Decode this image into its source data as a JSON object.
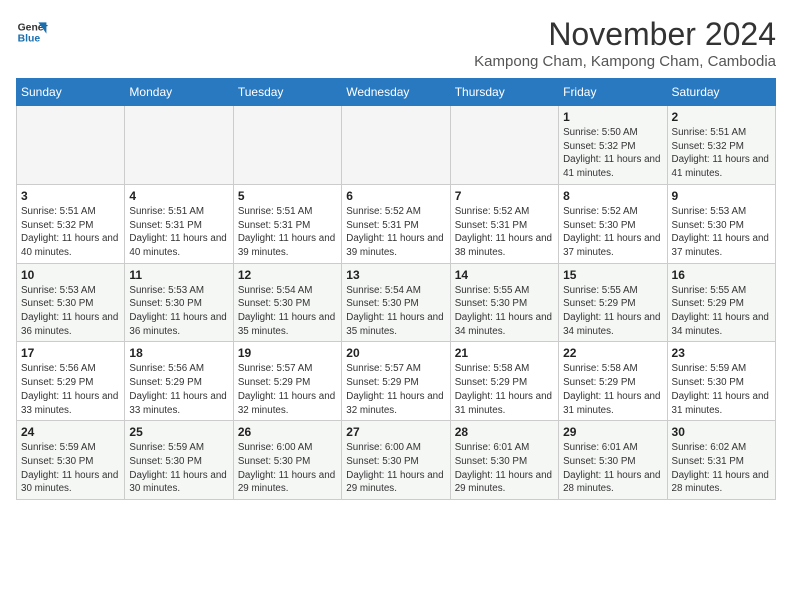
{
  "header": {
    "logo_line1": "General",
    "logo_line2": "Blue",
    "month_title": "November 2024",
    "location": "Kampong Cham, Kampong Cham, Cambodia"
  },
  "weekdays": [
    "Sunday",
    "Monday",
    "Tuesday",
    "Wednesday",
    "Thursday",
    "Friday",
    "Saturday"
  ],
  "weeks": [
    [
      {
        "day": "",
        "info": ""
      },
      {
        "day": "",
        "info": ""
      },
      {
        "day": "",
        "info": ""
      },
      {
        "day": "",
        "info": ""
      },
      {
        "day": "",
        "info": ""
      },
      {
        "day": "1",
        "info": "Sunrise: 5:50 AM\nSunset: 5:32 PM\nDaylight: 11 hours and 41 minutes."
      },
      {
        "day": "2",
        "info": "Sunrise: 5:51 AM\nSunset: 5:32 PM\nDaylight: 11 hours and 41 minutes."
      }
    ],
    [
      {
        "day": "3",
        "info": "Sunrise: 5:51 AM\nSunset: 5:32 PM\nDaylight: 11 hours and 40 minutes."
      },
      {
        "day": "4",
        "info": "Sunrise: 5:51 AM\nSunset: 5:31 PM\nDaylight: 11 hours and 40 minutes."
      },
      {
        "day": "5",
        "info": "Sunrise: 5:51 AM\nSunset: 5:31 PM\nDaylight: 11 hours and 39 minutes."
      },
      {
        "day": "6",
        "info": "Sunrise: 5:52 AM\nSunset: 5:31 PM\nDaylight: 11 hours and 39 minutes."
      },
      {
        "day": "7",
        "info": "Sunrise: 5:52 AM\nSunset: 5:31 PM\nDaylight: 11 hours and 38 minutes."
      },
      {
        "day": "8",
        "info": "Sunrise: 5:52 AM\nSunset: 5:30 PM\nDaylight: 11 hours and 37 minutes."
      },
      {
        "day": "9",
        "info": "Sunrise: 5:53 AM\nSunset: 5:30 PM\nDaylight: 11 hours and 37 minutes."
      }
    ],
    [
      {
        "day": "10",
        "info": "Sunrise: 5:53 AM\nSunset: 5:30 PM\nDaylight: 11 hours and 36 minutes."
      },
      {
        "day": "11",
        "info": "Sunrise: 5:53 AM\nSunset: 5:30 PM\nDaylight: 11 hours and 36 minutes."
      },
      {
        "day": "12",
        "info": "Sunrise: 5:54 AM\nSunset: 5:30 PM\nDaylight: 11 hours and 35 minutes."
      },
      {
        "day": "13",
        "info": "Sunrise: 5:54 AM\nSunset: 5:30 PM\nDaylight: 11 hours and 35 minutes."
      },
      {
        "day": "14",
        "info": "Sunrise: 5:55 AM\nSunset: 5:30 PM\nDaylight: 11 hours and 34 minutes."
      },
      {
        "day": "15",
        "info": "Sunrise: 5:55 AM\nSunset: 5:29 PM\nDaylight: 11 hours and 34 minutes."
      },
      {
        "day": "16",
        "info": "Sunrise: 5:55 AM\nSunset: 5:29 PM\nDaylight: 11 hours and 34 minutes."
      }
    ],
    [
      {
        "day": "17",
        "info": "Sunrise: 5:56 AM\nSunset: 5:29 PM\nDaylight: 11 hours and 33 minutes."
      },
      {
        "day": "18",
        "info": "Sunrise: 5:56 AM\nSunset: 5:29 PM\nDaylight: 11 hours and 33 minutes."
      },
      {
        "day": "19",
        "info": "Sunrise: 5:57 AM\nSunset: 5:29 PM\nDaylight: 11 hours and 32 minutes."
      },
      {
        "day": "20",
        "info": "Sunrise: 5:57 AM\nSunset: 5:29 PM\nDaylight: 11 hours and 32 minutes."
      },
      {
        "day": "21",
        "info": "Sunrise: 5:58 AM\nSunset: 5:29 PM\nDaylight: 11 hours and 31 minutes."
      },
      {
        "day": "22",
        "info": "Sunrise: 5:58 AM\nSunset: 5:29 PM\nDaylight: 11 hours and 31 minutes."
      },
      {
        "day": "23",
        "info": "Sunrise: 5:59 AM\nSunset: 5:30 PM\nDaylight: 11 hours and 31 minutes."
      }
    ],
    [
      {
        "day": "24",
        "info": "Sunrise: 5:59 AM\nSunset: 5:30 PM\nDaylight: 11 hours and 30 minutes."
      },
      {
        "day": "25",
        "info": "Sunrise: 5:59 AM\nSunset: 5:30 PM\nDaylight: 11 hours and 30 minutes."
      },
      {
        "day": "26",
        "info": "Sunrise: 6:00 AM\nSunset: 5:30 PM\nDaylight: 11 hours and 29 minutes."
      },
      {
        "day": "27",
        "info": "Sunrise: 6:00 AM\nSunset: 5:30 PM\nDaylight: 11 hours and 29 minutes."
      },
      {
        "day": "28",
        "info": "Sunrise: 6:01 AM\nSunset: 5:30 PM\nDaylight: 11 hours and 29 minutes."
      },
      {
        "day": "29",
        "info": "Sunrise: 6:01 AM\nSunset: 5:30 PM\nDaylight: 11 hours and 28 minutes."
      },
      {
        "day": "30",
        "info": "Sunrise: 6:02 AM\nSunset: 5:31 PM\nDaylight: 11 hours and 28 minutes."
      }
    ]
  ]
}
